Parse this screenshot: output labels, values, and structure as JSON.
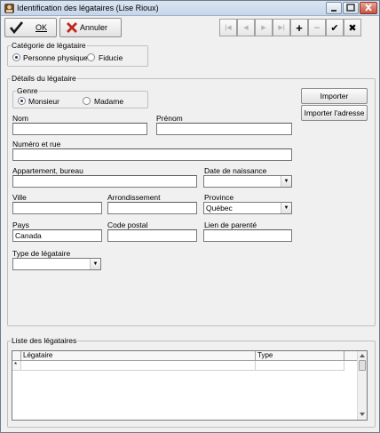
{
  "window": {
    "title": "Identification des légataires (Lise Rioux)"
  },
  "toolbar": {
    "ok_label": "OK",
    "cancel_label": "Annuler",
    "nav_buttons": [
      {
        "name": "first",
        "glyph": "|◀"
      },
      {
        "name": "prev",
        "glyph": "◀"
      },
      {
        "name": "next",
        "glyph": "▶"
      },
      {
        "name": "last",
        "glyph": "▶|"
      },
      {
        "name": "add",
        "glyph": "+"
      },
      {
        "name": "delete",
        "glyph": "−"
      },
      {
        "name": "confirm",
        "glyph": "✔"
      },
      {
        "name": "cancel",
        "glyph": "✖"
      }
    ]
  },
  "category": {
    "legend": "Catégorie de légataire",
    "options": [
      "Personne physique",
      "Fiducie"
    ],
    "selected": "Personne physique"
  },
  "details": {
    "legend": "Détails du légataire",
    "genre": {
      "legend": "Genre",
      "options": [
        "Monsieur",
        "Madame"
      ],
      "selected": "Monsieur"
    },
    "import_button": "Importer",
    "import_address_button": "Importer l'adresse",
    "fields": {
      "nom": {
        "label": "Nom",
        "value": ""
      },
      "prenom": {
        "label": "Prénom",
        "value": ""
      },
      "numero_rue": {
        "label": "Numéro et rue",
        "value": ""
      },
      "appartement": {
        "label": "Appartement, bureau",
        "value": ""
      },
      "date_naissance": {
        "label": "Date de naissance",
        "value": ""
      },
      "ville": {
        "label": "Ville",
        "value": ""
      },
      "arrondissement": {
        "label": "Arrondissement",
        "value": ""
      },
      "province": {
        "label": "Province",
        "value": "Québec"
      },
      "pays": {
        "label": "Pays",
        "value": "Canada"
      },
      "code_postal": {
        "label": "Code postal",
        "value": ""
      },
      "lien_parente": {
        "label": "Lien de parenté",
        "value": ""
      },
      "type_legataire": {
        "label": "Type de légataire",
        "value": ""
      }
    }
  },
  "list": {
    "legend": "Liste des légataires",
    "columns": [
      "Légataire",
      "Type"
    ],
    "new_row_marker": "*"
  }
}
